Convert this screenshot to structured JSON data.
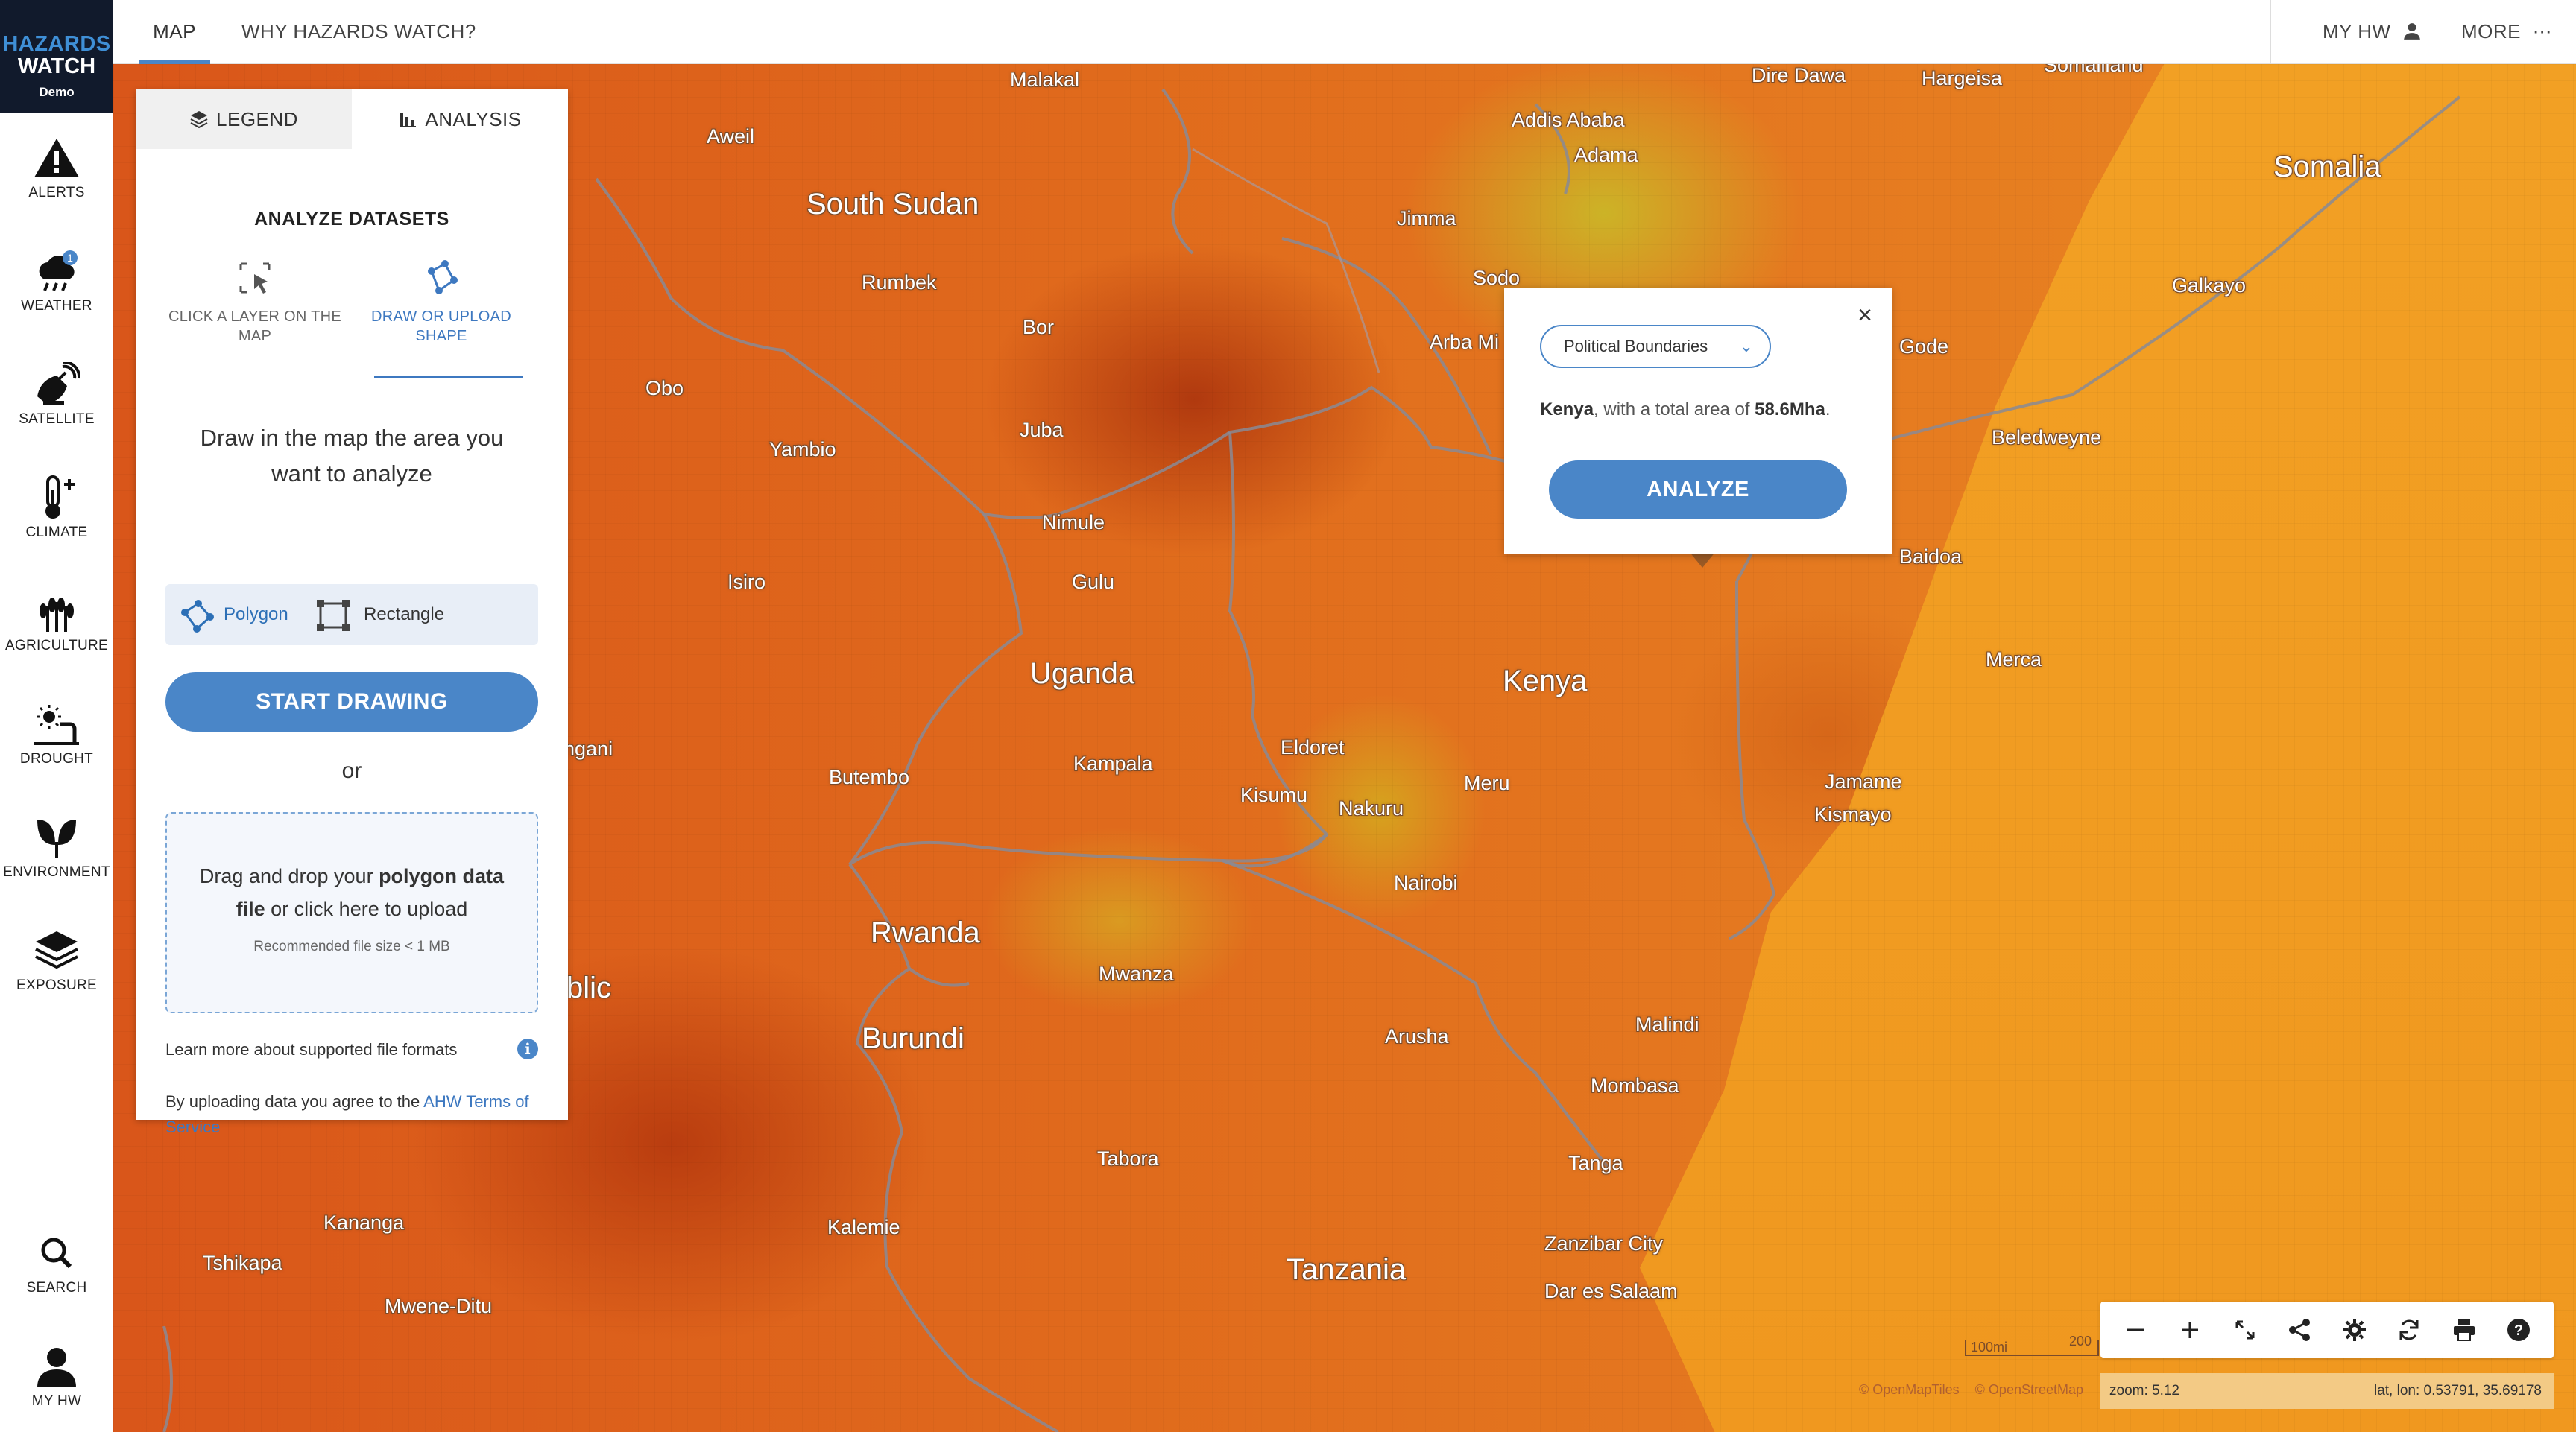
{
  "logo": {
    "line1": "HAZARDS",
    "line2": "WATCH",
    "line3": "Demo"
  },
  "topnav": {
    "map": "MAP",
    "why": "WHY HAZARDS WATCH?",
    "myhw": "MY HW",
    "more": "MORE"
  },
  "sidebar": {
    "items": [
      {
        "label": "ALERTS",
        "icon": "alert-icon"
      },
      {
        "label": "WEATHER",
        "icon": "weather-icon",
        "badge": "1"
      },
      {
        "label": "SATELLITE",
        "icon": "satellite-icon"
      },
      {
        "label": "CLIMATE",
        "icon": "thermometer-icon"
      },
      {
        "label": "AGRICULTURE",
        "icon": "wheat-icon"
      },
      {
        "label": "DROUGHT",
        "icon": "drought-icon"
      },
      {
        "label": "ENVIRONMENT",
        "icon": "leaf-icon"
      },
      {
        "label": "EXPOSURE",
        "icon": "layers-icon"
      }
    ],
    "search": "SEARCH",
    "myhw": "MY HW"
  },
  "panel": {
    "tabs": {
      "legend": "LEGEND",
      "analysis": "ANALYSIS"
    },
    "title": "ANALYZE DATASETS",
    "mode_click": "CLICK A LAYER ON THE MAP",
    "mode_draw": "DRAW OR UPLOAD SHAPE",
    "instructions": "Draw in the map the area you want to analyze",
    "shape_polygon": "Polygon",
    "shape_rectangle": "Rectangle",
    "start_button": "START DRAWING",
    "or": "or",
    "drop_pre": "Drag and drop your ",
    "drop_bold": "polygon data file",
    "drop_post": " or click here to upload",
    "drop_note": "Recommended file size < 1 MB",
    "learn_more": "Learn more about supported file formats",
    "terms_pre": "By uploading data you agree to the ",
    "terms_link": "AHW Terms of Service"
  },
  "popup": {
    "select_value": "Political Boundaries",
    "country": "Kenya",
    "info_mid": ", with a total area of ",
    "area": "58.6Mha",
    "info_end": ".",
    "analyze_button": "ANALYZE"
  },
  "map": {
    "labels": [
      {
        "text": "Malakal",
        "type": "city"
      },
      {
        "text": "Dire Dawa",
        "type": "city"
      },
      {
        "text": "Hargeisa",
        "type": "city"
      },
      {
        "text": "Somaliland",
        "type": "city"
      },
      {
        "text": "Addis Ababa",
        "type": "city"
      },
      {
        "text": "Adama",
        "type": "city"
      },
      {
        "text": "Aweil",
        "type": "city"
      },
      {
        "text": "South Sudan",
        "type": "country"
      },
      {
        "text": "Somalia",
        "type": "country"
      },
      {
        "text": "Jimma",
        "type": "city"
      },
      {
        "text": "Sodo",
        "type": "city"
      },
      {
        "text": "Galkayo",
        "type": "city"
      },
      {
        "text": "Rumbek",
        "type": "city"
      },
      {
        "text": "Bor",
        "type": "city"
      },
      {
        "text": "Arba Mi",
        "type": "city"
      },
      {
        "text": "Gode",
        "type": "city"
      },
      {
        "text": "Obo",
        "type": "city"
      },
      {
        "text": "Juba",
        "type": "city"
      },
      {
        "text": "Yambio",
        "type": "city"
      },
      {
        "text": "Beledweyne",
        "type": "city"
      },
      {
        "text": "Nimule",
        "type": "city"
      },
      {
        "text": "Baidoa",
        "type": "city"
      },
      {
        "text": "Isiro",
        "type": "city"
      },
      {
        "text": "Gulu",
        "type": "city"
      },
      {
        "text": "Uganda",
        "type": "country"
      },
      {
        "text": "Kenya",
        "type": "country"
      },
      {
        "text": "Merca",
        "type": "city"
      },
      {
        "text": "ngani",
        "type": "city"
      },
      {
        "text": "Eldoret",
        "type": "city"
      },
      {
        "text": "Butembo",
        "type": "city"
      },
      {
        "text": "Kampala",
        "type": "city"
      },
      {
        "text": "Meru",
        "type": "city"
      },
      {
        "text": "Jamame",
        "type": "city"
      },
      {
        "text": "Kisumu",
        "type": "city"
      },
      {
        "text": "Nakuru",
        "type": "city"
      },
      {
        "text": "Kismayo",
        "type": "city"
      },
      {
        "text": "Nairobi",
        "type": "city"
      },
      {
        "text": "Rwanda",
        "type": "country"
      },
      {
        "text": "Mwanza",
        "type": "city"
      },
      {
        "text": "blic",
        "type": "country"
      },
      {
        "text": "Burundi",
        "type": "country"
      },
      {
        "text": "Malindi",
        "type": "city"
      },
      {
        "text": "Arusha",
        "type": "city"
      },
      {
        "text": "Mombasa",
        "type": "city"
      },
      {
        "text": "Tabora",
        "type": "city"
      },
      {
        "text": "Tanga",
        "type": "city"
      },
      {
        "text": "Kananga",
        "type": "city"
      },
      {
        "text": "Kalemie",
        "type": "city"
      },
      {
        "text": "Zanzibar City",
        "type": "city"
      },
      {
        "text": "Tshikapa",
        "type": "city"
      },
      {
        "text": "Tanzania",
        "type": "country"
      },
      {
        "text": "Dar es Salaam",
        "type": "city"
      },
      {
        "text": "Mwene-Ditu",
        "type": "city"
      }
    ],
    "scale_left": "100mi",
    "scale_right": "200",
    "attribution_1": "© OpenMapTiles",
    "attribution_2": "© OpenStreetMap"
  },
  "controls": {
    "icons": [
      "zoom-out-icon",
      "zoom-in-icon",
      "fullscreen-icon",
      "share-icon",
      "settings-icon",
      "reset-icon",
      "print-icon",
      "help-icon"
    ]
  },
  "status": {
    "zoom": "zoom: 5.12",
    "latlon": "lat, lon: 0.53791, 35.69178"
  }
}
